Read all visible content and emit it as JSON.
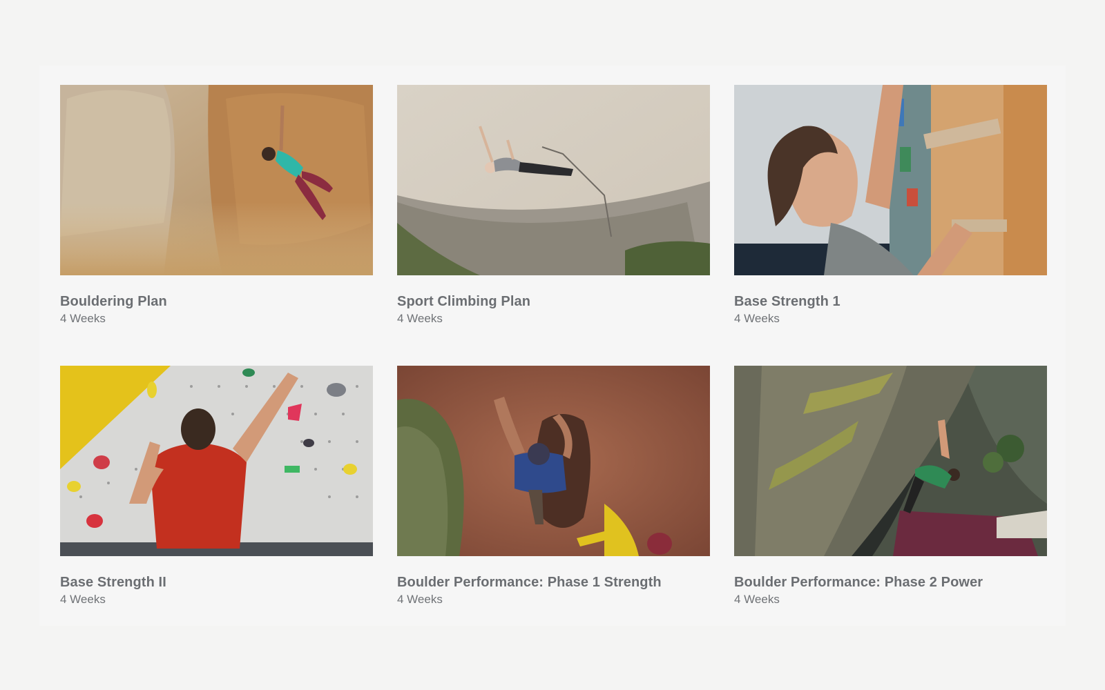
{
  "plans": [
    {
      "title": "Bouldering Plan",
      "meta": "4 Weeks",
      "image": "woman-bouldering-desert-photo"
    },
    {
      "title": "Sport Climbing Plan",
      "meta": "4 Weeks",
      "image": "climber-overhang-limestone-photo"
    },
    {
      "title": "Base Strength 1",
      "meta": "4 Weeks",
      "image": "climber-hangboard-closeup-photo"
    },
    {
      "title": "Base Strength II",
      "meta": "4 Weeks",
      "image": "man-gym-climbing-wall-photo"
    },
    {
      "title": "Boulder Performance: Phase 1 Strength",
      "meta": "4 Weeks",
      "image": "climber-red-rock-topdown-photo"
    },
    {
      "title": "Boulder Performance: Phase 2 Power",
      "meta": "4 Weeks",
      "image": "climber-lichen-boulder-photo"
    }
  ]
}
